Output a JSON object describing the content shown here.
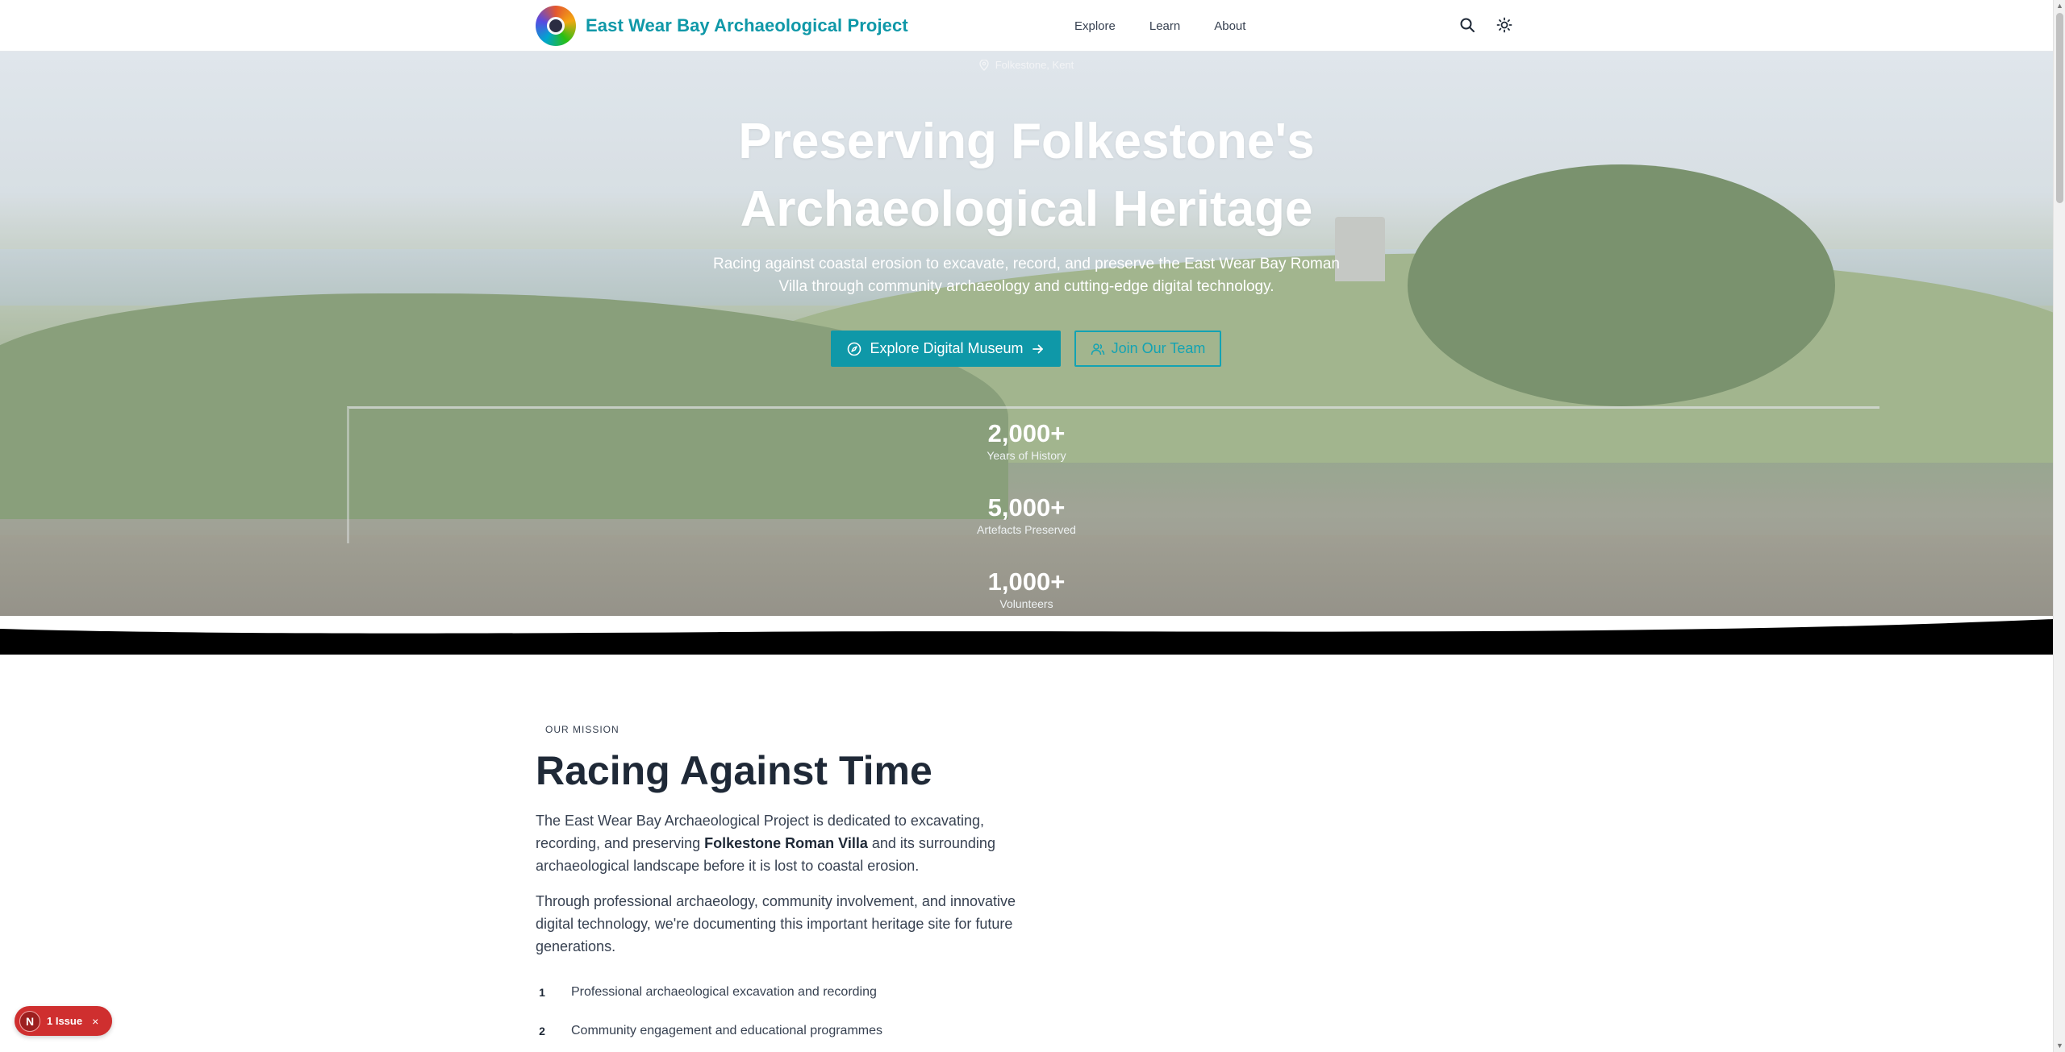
{
  "nav": {
    "brand": "East Wear Bay Archaeological Project",
    "links": [
      "Explore",
      "Learn",
      "About"
    ],
    "icons": [
      "search-icon",
      "sun-icon"
    ]
  },
  "hero": {
    "location": "Folkestone, Kent",
    "title_line1": "Preserving Folkestone's",
    "title_line2": "Archaeological Heritage",
    "subtitle": "Racing against coastal erosion to excavate, record, and preserve the East Wear Bay Roman Villa through community archaeology and cutting-edge digital technology.",
    "primary_button": "Explore Digital Museum",
    "secondary_button": "Join Our Team",
    "stats": [
      {
        "value": "2,000+",
        "label": "Years of History"
      },
      {
        "value": "5,000+",
        "label": "Artefacts Preserved"
      },
      {
        "value": "1,000+",
        "label": "Volunteers"
      }
    ]
  },
  "mission": {
    "eyebrow": "OUR MISSION",
    "title": "Racing Against Time",
    "para1_start": "The East Wear Bay Archaeological Project is dedicated to excavating, recording, and preserving ",
    "para1_bold": "Folkestone Roman Villa",
    "para1_end": " and its surrounding archaeological landscape before it is lost to coastal erosion.",
    "para2": "Through professional archaeology, community involvement, and innovative digital technology, we're documenting this important heritage site for future generations.",
    "list": [
      {
        "num": "1",
        "text": "Professional archaeological excavation and recording"
      },
      {
        "num": "2",
        "text": "Community engagement and educational programmes"
      }
    ]
  },
  "issue_badge": {
    "avatar": "N",
    "text": "1 Issue",
    "close": "×"
  },
  "colors": {
    "accent": "#0f98a8",
    "issue": "#cf2f2f"
  }
}
